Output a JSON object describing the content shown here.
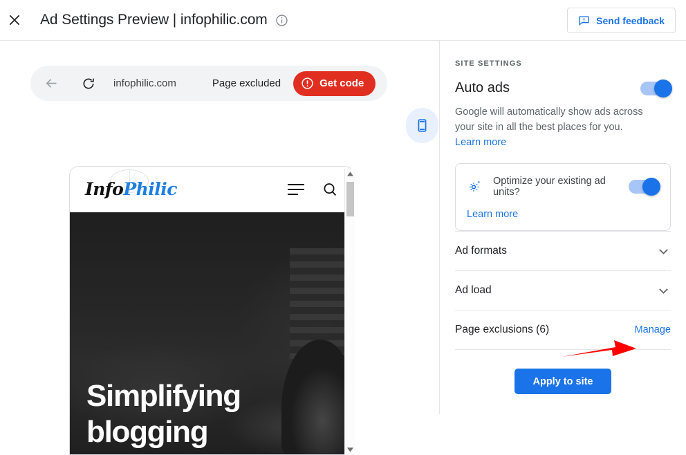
{
  "topbar": {
    "close_icon": "close-icon",
    "title": "Ad Settings Preview | infophilic.com",
    "info_icon": "info-icon",
    "feedback_label": "Send feedback",
    "feedback_icon": "feedback-icon"
  },
  "browser": {
    "back_icon": "back-arrow-icon",
    "reload_icon": "reload-icon",
    "url": "infophilic.com",
    "page_status": "Page excluded",
    "get_code_label": "Get code",
    "get_code_icon": "error-circle-icon",
    "device_icon": "mobile-device-icon"
  },
  "preview": {
    "logo_part1": "Info",
    "logo_part2": "Philic",
    "menu_icon": "hamburger-menu-icon",
    "search_icon": "search-icon",
    "hero_line1": "Simplifying",
    "hero_line2": "blogging",
    "scroll_up_icon": "scroll-up-arrow-icon",
    "scroll_down_icon": "scroll-down-arrow-icon"
  },
  "settings": {
    "section_label": "SITE SETTINGS",
    "auto_ads_title": "Auto ads",
    "auto_ads_toggle": "on",
    "description": "Google will automatically show ads across your site in all the best places for you.",
    "description_link": "Learn more",
    "optimize": {
      "icon": "auto-optimize-gear-icon",
      "label": "Optimize your existing ad units?",
      "toggle": "on",
      "learn_more": "Learn more"
    },
    "accordions": [
      {
        "title": "Ad formats",
        "icon": "chevron-down-icon"
      },
      {
        "title": "Ad load",
        "icon": "chevron-down-icon"
      }
    ],
    "page_exclusions": {
      "title": "Page exclusions (6)",
      "manage_label": "Manage"
    },
    "apply_label": "Apply to site"
  },
  "colors": {
    "accent_blue": "#1a73e8",
    "danger_red": "#e02f20",
    "annotation_red": "#ff0000",
    "toggle_track": "#a7c5f7",
    "text_primary": "#202124",
    "text_secondary": "#5f6368"
  }
}
